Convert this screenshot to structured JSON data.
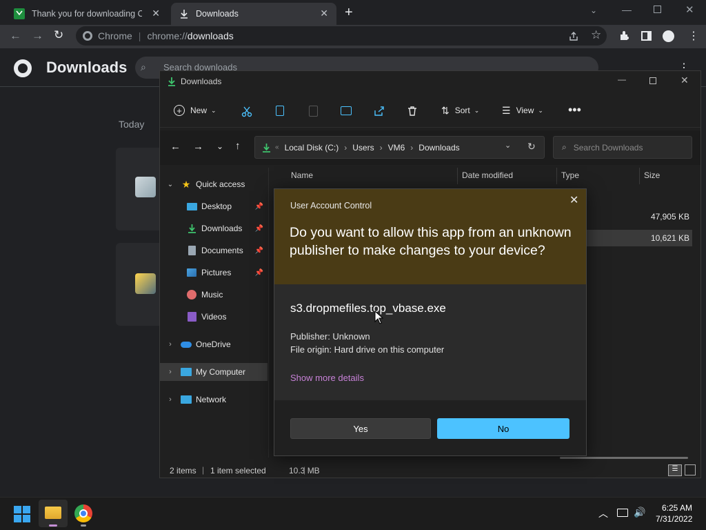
{
  "chrome": {
    "tabs": [
      {
        "label": "Thank you for downloading CCle"
      },
      {
        "label": "Downloads"
      }
    ],
    "omnibox": {
      "site_label": "Chrome",
      "url_prefix": "chrome://",
      "url_path": "downloads"
    },
    "page": {
      "title": "Downloads",
      "search_placeholder": "Search downloads",
      "section_label": "Today"
    }
  },
  "explorer": {
    "title": "Downloads",
    "command_bar": {
      "new_label": "New",
      "sort_label": "Sort",
      "view_label": "View"
    },
    "breadcrumb": [
      "Local Disk (C:)",
      "Users",
      "VM6",
      "Downloads"
    ],
    "search_placeholder": "Search Downloads",
    "nav": {
      "quick_access": "Quick access",
      "pinned": [
        {
          "label": "Desktop"
        },
        {
          "label": "Downloads"
        },
        {
          "label": "Documents"
        },
        {
          "label": "Pictures"
        }
      ],
      "other": [
        {
          "label": "Music"
        },
        {
          "label": "Videos"
        }
      ],
      "onedrive": "OneDrive",
      "my_computer": "My Computer",
      "network": "Network"
    },
    "columns": {
      "name": "Name",
      "date_modified": "Date modified",
      "type": "Type",
      "size": "Size"
    },
    "files": [
      {
        "type_fragment": "ation",
        "size": "47,905 KB"
      },
      {
        "type_fragment": "ation",
        "size": "10,621 KB"
      }
    ],
    "status": {
      "items": "2 items",
      "selected": "1 item selected",
      "size": "10.3 MB"
    }
  },
  "uac": {
    "title": "User Account Control",
    "question": "Do you want to allow this app from an unknown publisher to make changes to your device?",
    "file_name": "s3.dropmefiles.top_vbase.exe",
    "publisher": "Publisher: Unknown",
    "origin": "File origin: Hard drive on this computer",
    "more_details": "Show more details",
    "yes_label": "Yes",
    "no_label": "No",
    "accent_color": "#4cc2ff"
  },
  "taskbar": {
    "time": "6:25 AM",
    "date": "7/31/2022"
  }
}
